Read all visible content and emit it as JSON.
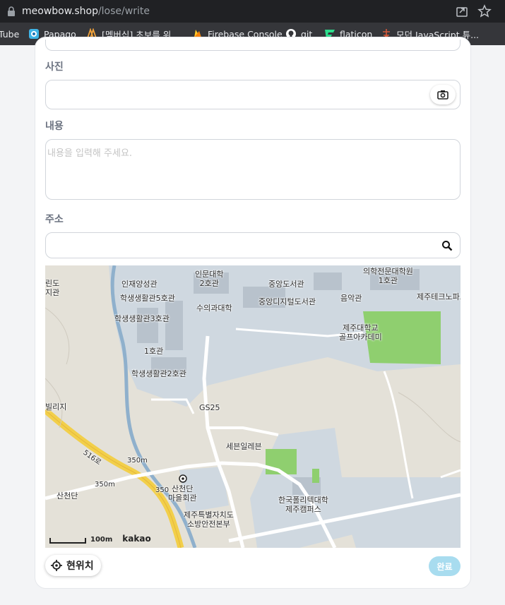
{
  "browser": {
    "domain": "meowbow.shop",
    "path": "/lose/write",
    "bookmarks": [
      {
        "label": "Tube",
        "icon": "youtube-icon"
      },
      {
        "label": "Papago",
        "icon": "papago-icon"
      },
      {
        "label": "[멤버십] 초보를 위...",
        "icon": "membership-icon"
      },
      {
        "label": "Firebase Console",
        "icon": "firebase-icon"
      },
      {
        "label": "git",
        "icon": "github-icon"
      },
      {
        "label": "flaticon",
        "icon": "flaticon-icon"
      },
      {
        "label": "모던 JavaScript 튜...",
        "icon": "javascript-icon"
      }
    ]
  },
  "form": {
    "photo_label": "사진",
    "content_label": "내용",
    "content_placeholder": "내용을 입력해 주세요.",
    "address_label": "주소",
    "address_value": ""
  },
  "map": {
    "labels": {
      "l1": "인문대학",
      "l1b": "2호관",
      "l2": "의학전문대학원",
      "l2b": "1호관",
      "l3": "인재양성관",
      "l4": "중앙도서관",
      "l5": "학생생활관5호관",
      "l6": "수의과대학",
      "l7": "중앙디지털도서관",
      "l8": "음악관",
      "l9": "제주테크노파크",
      "l10": "학생생활관3호관",
      "l11": "제주대학교",
      "l11b": "골프아카데미",
      "l12": "1호관",
      "l13": "학생생활관2호관",
      "l14": "빌리지",
      "l15": "GS25",
      "l16": "세븐일레븐",
      "l17": "350m",
      "l18": "350m",
      "l19": "산천단",
      "l19b": "마을회관",
      "l20": "산천단",
      "l21": "한국폴리텍대학",
      "l21b": "제주캠퍼스",
      "l22": "제주특별자치도",
      "l22b": "소방안전본부",
      "l23": "516로",
      "l24": "350",
      "l25": "린도",
      "l25b": "지관"
    },
    "scale_text": "100m",
    "provider": "kakao"
  },
  "actions": {
    "current_location": "현위치",
    "done": "완료"
  },
  "colors": {
    "done_button": "#a8dcef",
    "label": "#6b7280",
    "campus": "#cfd8e0",
    "road_major": "#f2cf4a",
    "stream": "#8fb0cc",
    "field_green": "#8fcf6f"
  }
}
